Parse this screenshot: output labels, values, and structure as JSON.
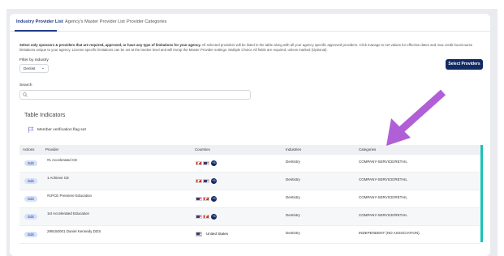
{
  "tabs": [
    {
      "label": "Industry Provider List",
      "active": true
    },
    {
      "label": "Agency's Master Provider List",
      "active": false
    },
    {
      "label": "Provider Categories",
      "active": false
    }
  ],
  "intro": {
    "bold": "Select only sponsors & providers that are required, approved, or have any type of limitations for your agency.",
    "rest": " All selected providers will be listed in the table along with all your agency specific approved providers. Click manage to set values for effective dates and max credit hour/course limitations unique to your agency. License specific limitations can be set at the tracker level and will trump the Master Provider settings. Multiple Choice All fields are required, unless marked (Optional)."
  },
  "filter": {
    "label": "Filter by industry",
    "value": "Dentist"
  },
  "select_providers_label": "Select Providers",
  "search": {
    "label": "Search",
    "placeholder": ""
  },
  "indicators": {
    "title": "Table Indicators",
    "item": "Member verification flag set"
  },
  "table": {
    "headers": [
      "Actions",
      "Provider",
      "Countries",
      "Industries",
      "Categories"
    ],
    "rows": [
      {
        "action": "Edit",
        "provider": "#1 Accelerated CE",
        "countries": [
          "ca",
          "us"
        ],
        "more": "+3",
        "country_text": "",
        "industry": "Dentistry",
        "category": "COMPANY-SERVICE/RETAIL"
      },
      {
        "action": "Edit",
        "provider": "1 Achieve CE",
        "countries": [
          "ca",
          "us"
        ],
        "more": "+3",
        "country_text": "",
        "industry": "Dentistry",
        "category": "COMPANY-SERVICE/RETAIL"
      },
      {
        "action": "Edit",
        "provider": "#1PCE Premiere Education",
        "countries": [
          "us",
          "ca"
        ],
        "more": "+3",
        "country_text": "",
        "industry": "Dentistry",
        "category": "COMPANY-SERVICE/RETAIL"
      },
      {
        "action": "Edit",
        "provider": "1st Accelerated Education",
        "countries": [
          "us",
          "ca"
        ],
        "more": "+3",
        "country_text": "",
        "industry": "Dentistry",
        "category": "COMPANY-SERVICE/RETAIL"
      },
      {
        "action": "Edit",
        "provider": "299150001 Daniel Kennedy DDS",
        "countries": [
          "us"
        ],
        "more": "",
        "country_text": "United States",
        "industry": "Dentistry",
        "category": "INDEPENDENT (NO ASSOCIATION)"
      }
    ]
  },
  "colors": {
    "accent": "#132b63",
    "arrow": "#b15fd6",
    "scrollbar": "#19c3b5"
  }
}
